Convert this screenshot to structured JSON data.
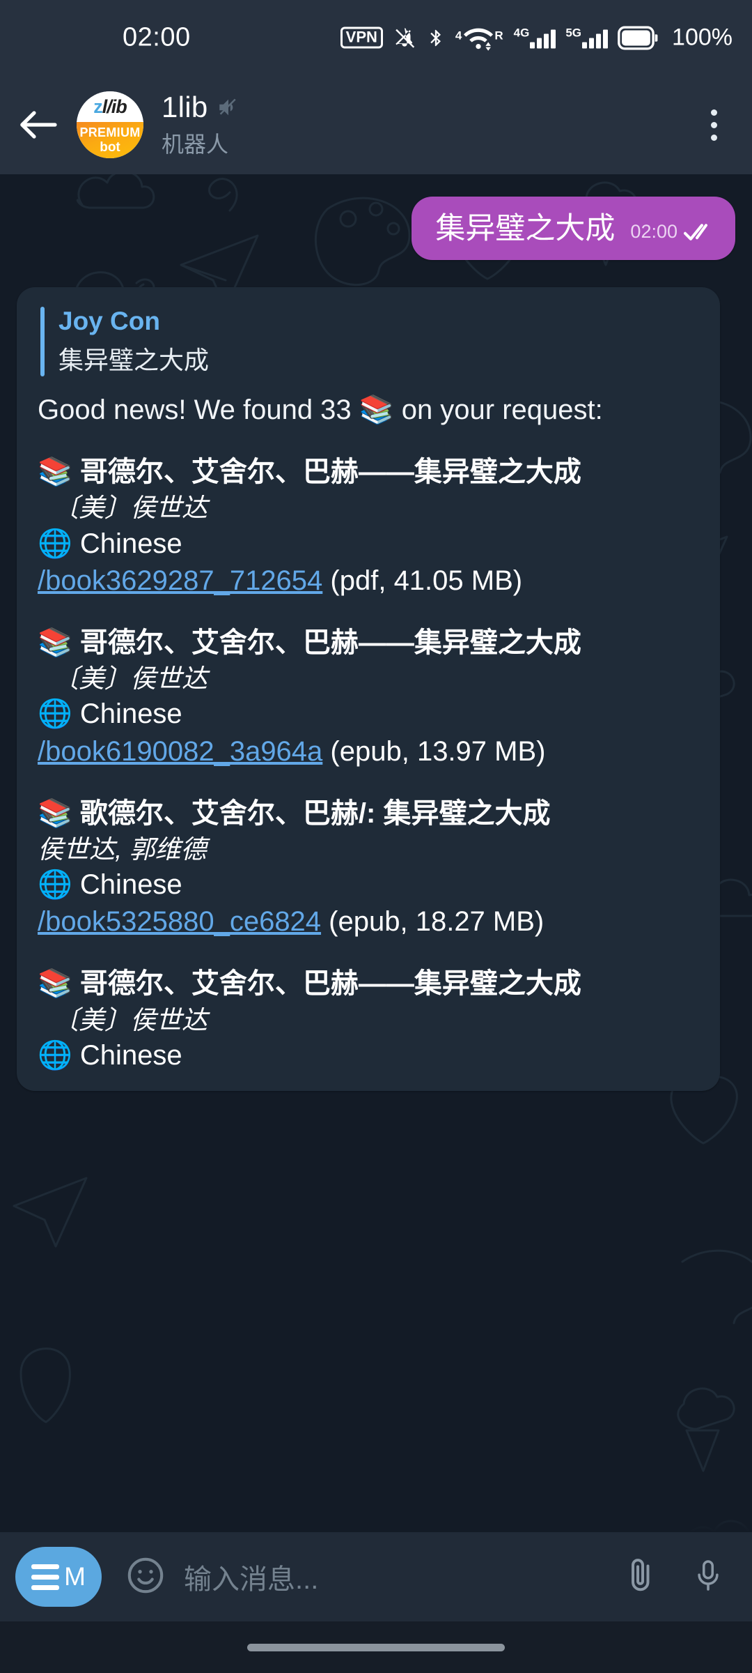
{
  "status_bar": {
    "clock": "02:00",
    "vpn_label": "VPN",
    "icons": [
      "vpn-badge",
      "bell-muted-icon",
      "bluetooth-icon",
      "wifi-icon",
      "signal-4g-icon",
      "signal-5g-icon",
      "battery-icon"
    ],
    "network_4g_label": "4G",
    "network_5g_label": "5G",
    "wifi_sub_label": "4",
    "roaming_label": "R",
    "battery_percent": "100%"
  },
  "header": {
    "back_icon": "back-arrow-icon",
    "avatar": {
      "top_text_z": "z",
      "top_text_lib": "l/ib",
      "premium_label": "PREMIUM",
      "bot_label": "bot"
    },
    "title": "1lib",
    "mute_icon": "mute-icon",
    "subtitle": "机器人",
    "menu_icon": "kebab-menu-icon"
  },
  "chat": {
    "outgoing_message": {
      "text": "集异璧之大成",
      "time": "02:00",
      "status_icon": "double-check-icon"
    },
    "incoming_message": {
      "reply_quote": {
        "name": "Joy Con",
        "text": "集异璧之大成"
      },
      "intro_text": "Good news! We found 33 📚 on your request:",
      "books": [
        {
          "emoji": "📚",
          "title": "哥德尔、艾舍尔、巴赫——集异璧之大成",
          "author": "〔美〕侯世达",
          "author_indent": true,
          "lang_emoji": "🌐",
          "language": "Chinese",
          "link": "/book3629287_712654",
          "meta": "(pdf, 41.05 MB)"
        },
        {
          "emoji": "📚",
          "title": "哥德尔、艾舍尔、巴赫——集异璧之大成",
          "author": "〔美〕侯世达",
          "author_indent": true,
          "lang_emoji": "🌐",
          "language": "Chinese",
          "link": "/book6190082_3a964a",
          "meta": "(epub, 13.97 MB)"
        },
        {
          "emoji": "📚",
          "title": "歌德尔、艾舍尔、巴赫/: 集异璧之大成",
          "author": "侯世达, 郭维德",
          "author_indent": false,
          "lang_emoji": "🌐",
          "language": "Chinese",
          "link": "/book5325880_ce6824",
          "meta": "(epub, 18.27 MB)"
        },
        {
          "emoji": "📚",
          "title": "哥德尔、艾舍尔、巴赫——集异璧之大成",
          "author": "〔美〕侯世达",
          "author_indent": true,
          "lang_emoji": "🌐",
          "language": "Chinese",
          "link": "",
          "meta": ""
        }
      ]
    }
  },
  "input_bar": {
    "menu_label": "M",
    "emoji_icon": "smiley-icon",
    "placeholder": "输入消息...",
    "attach_icon": "paperclip-icon",
    "mic_icon": "microphone-icon"
  },
  "colors": {
    "outgoing_bubble": "#a94cbb",
    "incoming_bubble": "#1f2b38",
    "link": "#62a8e8",
    "accent_blue": "#5ba8e0",
    "header_bg": "#27313f",
    "chat_bg": "#131b26"
  }
}
